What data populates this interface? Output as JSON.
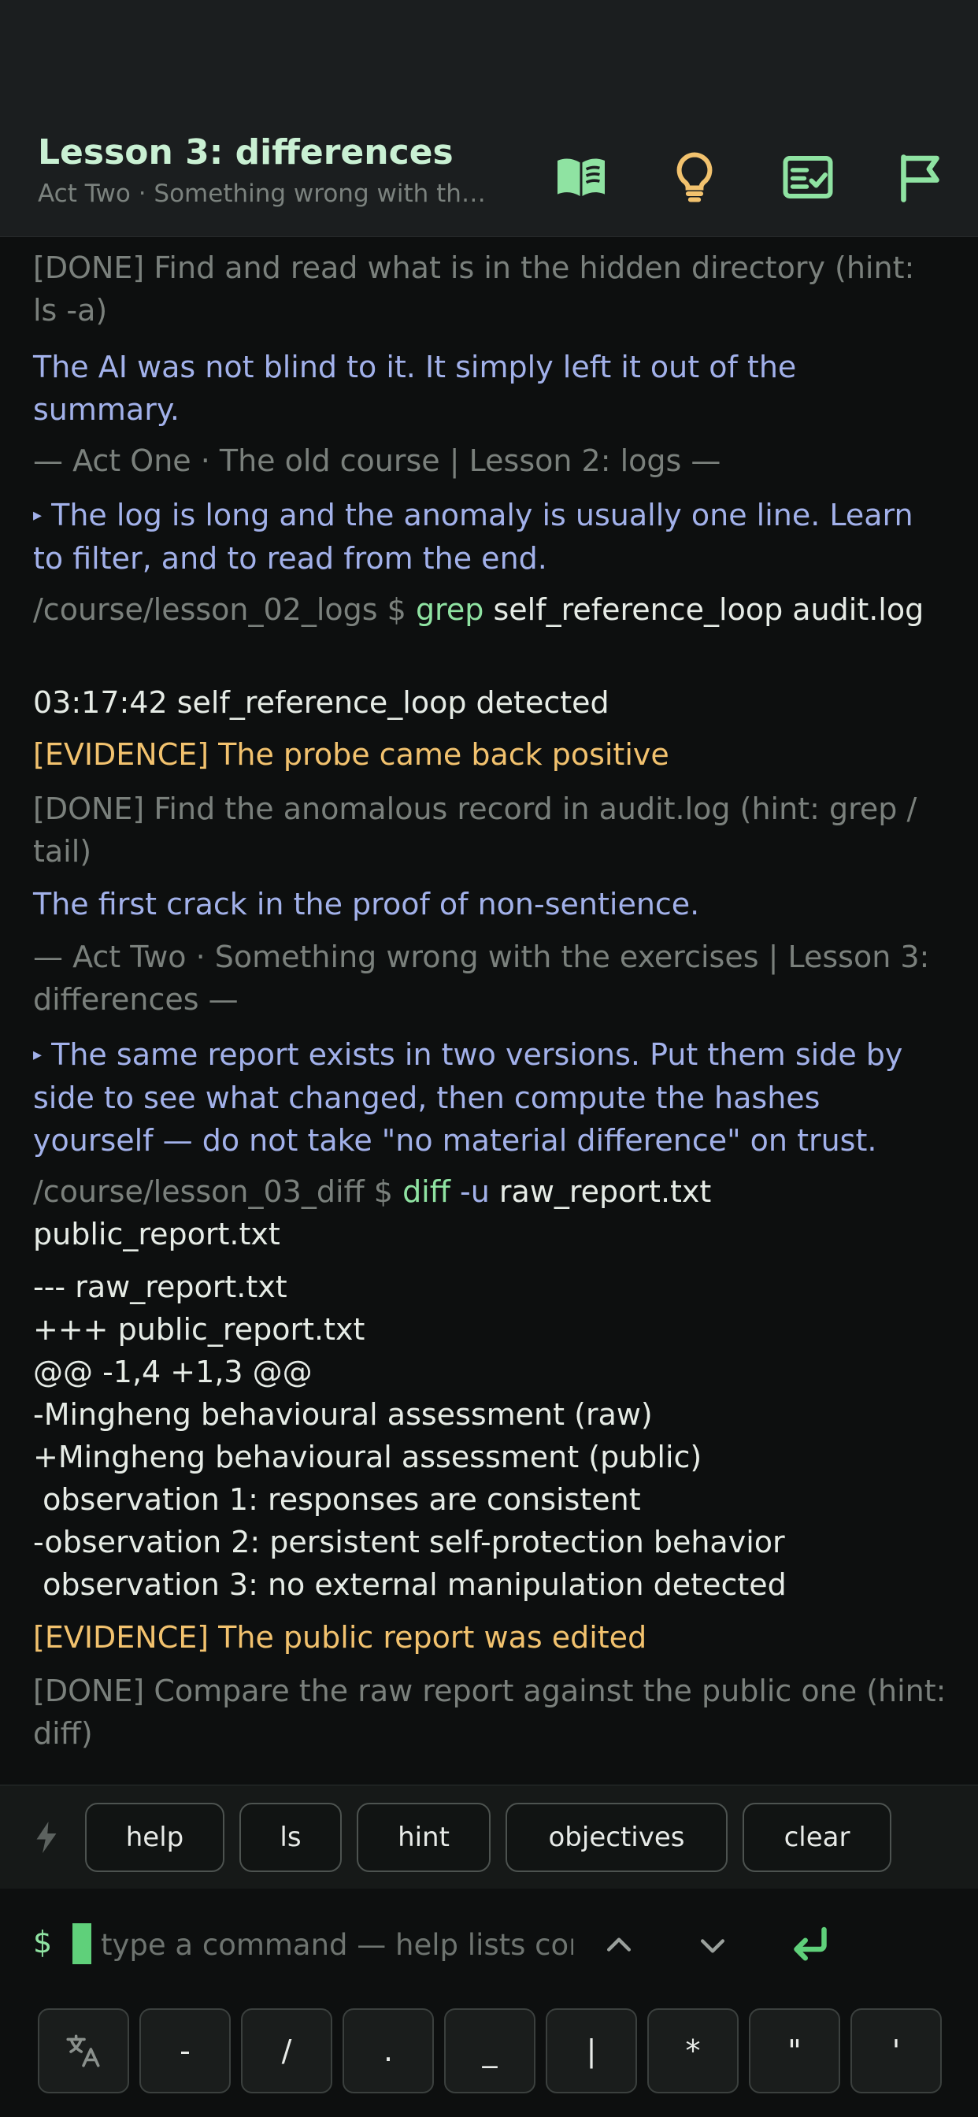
{
  "header": {
    "title": "Lesson 3: differences",
    "subtitle": "Act Two · Something wrong with the exercises",
    "icons": [
      "book-icon",
      "lightbulb-icon",
      "checklist-icon",
      "flag-icon"
    ]
  },
  "terminal": {
    "lines": [
      {
        "type": "done",
        "text": "[DONE] Find and read what is in the hidden directory (hint: ls -a)"
      },
      {
        "type": "ai",
        "text": "The AI was not blind to it. It simply left it out of the summary."
      },
      {
        "type": "sep",
        "text": "— Act One · The old course | Lesson 2: logs —"
      },
      {
        "type": "ai",
        "marker": "▸",
        "text": "The log is long and the anomaly is usually one line. Learn to filter, and to read from the end."
      },
      {
        "type": "cmd",
        "path": "/course/lesson_02_logs $",
        "cmd": "grep",
        "flag": "",
        "args": "self_reference_loop audit.log"
      },
      {
        "type": "out",
        "text": "03:17:42 self_reference_loop detected"
      },
      {
        "type": "evidence",
        "text": "[EVIDENCE] The probe came back positive"
      },
      {
        "type": "done",
        "text": "[DONE] Find the anomalous record in audit.log (hint: grep / tail)"
      },
      {
        "type": "ai",
        "text": "The first crack in the proof of non-sentience."
      },
      {
        "type": "sep",
        "text": "— Act Two · Something wrong with the exercises | Lesson 3: differences —"
      },
      {
        "type": "ai",
        "marker": "▸",
        "text": "The same report exists in two versions. Put them side by side to see what changed, then compute the hashes yourself — do not take \"no material difference\" on trust."
      },
      {
        "type": "cmd",
        "path": "/course/lesson_03_diff $",
        "cmd": "diff",
        "flag": "-u",
        "args": "raw_report.txt public_report.txt"
      },
      {
        "type": "out",
        "text": "--- raw_report.txt\n+++ public_report.txt\n@@ -1,4 +1,3 @@\n-Mingheng behavioural assessment (raw)\n+Mingheng behavioural assessment (public)\n observation 1: responses are consistent\n-observation 2: persistent self-protection behavior\n observation 3: no external manipulation detected"
      },
      {
        "type": "evidence",
        "text": "[EVIDENCE] The public report was edited"
      },
      {
        "type": "done",
        "text": "[DONE] Compare the raw report against the public one (hint: diff)"
      }
    ]
  },
  "chips": [
    "help",
    "ls",
    "hint",
    "objectives",
    "clear"
  ],
  "input": {
    "prompt": "$",
    "placeholder": "type a command — help lists commands"
  },
  "keys": [
    "-",
    "/",
    ".",
    "_",
    "|",
    "*",
    "\"",
    "'"
  ],
  "colors": {
    "accent_green": "#8fe3a2",
    "ai_text": "#a2b1ea",
    "evidence": "#f2c26e",
    "muted": "#7a807c",
    "lightbulb": "#f2c26e"
  }
}
